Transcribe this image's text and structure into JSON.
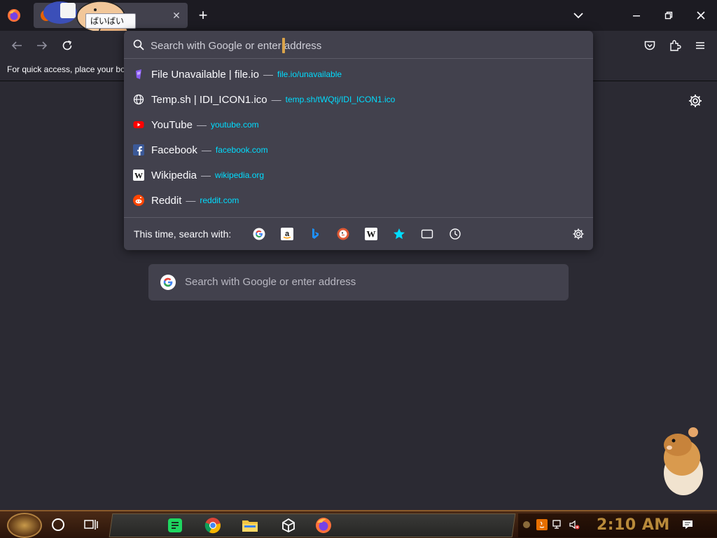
{
  "tabstrip": {
    "tooltip_text": "ばいばい"
  },
  "bookmarks": {
    "hint": "For quick access, place your bookmarks here"
  },
  "urlbar": {
    "placeholder": "Search with Google or enter address",
    "results": [
      {
        "title": "File Unavailable | file.io",
        "url": "file.io/unavailable",
        "icon": "file-io-icon"
      },
      {
        "title": "Temp.sh | IDI_ICON1.ico",
        "url": "temp.sh/tWQtj/IDI_ICON1.ico",
        "icon": "globe-icon"
      },
      {
        "title": "YouTube",
        "url": "youtube.com",
        "icon": "youtube-icon"
      },
      {
        "title": "Facebook",
        "url": "facebook.com",
        "icon": "facebook-icon"
      },
      {
        "title": "Wikipedia",
        "url": "wikipedia.org",
        "icon": "wikipedia-icon"
      },
      {
        "title": "Reddit",
        "url": "reddit.com",
        "icon": "reddit-icon"
      }
    ],
    "separator": "—",
    "oneoff_label": "This time, search with:",
    "engines": [
      "google-icon",
      "amazon-icon",
      "bing-icon",
      "duckduckgo-icon",
      "wikipedia-icon",
      "bookmarks-star-icon",
      "tabs-icon",
      "history-icon"
    ]
  },
  "page": {
    "search_placeholder": "Search with Google or enter address"
  },
  "taskbar": {
    "clock": "2:10 AM"
  },
  "colors": {
    "accent_url": "#00ddff",
    "panel": "#42414d",
    "background": "#2b2a33"
  }
}
